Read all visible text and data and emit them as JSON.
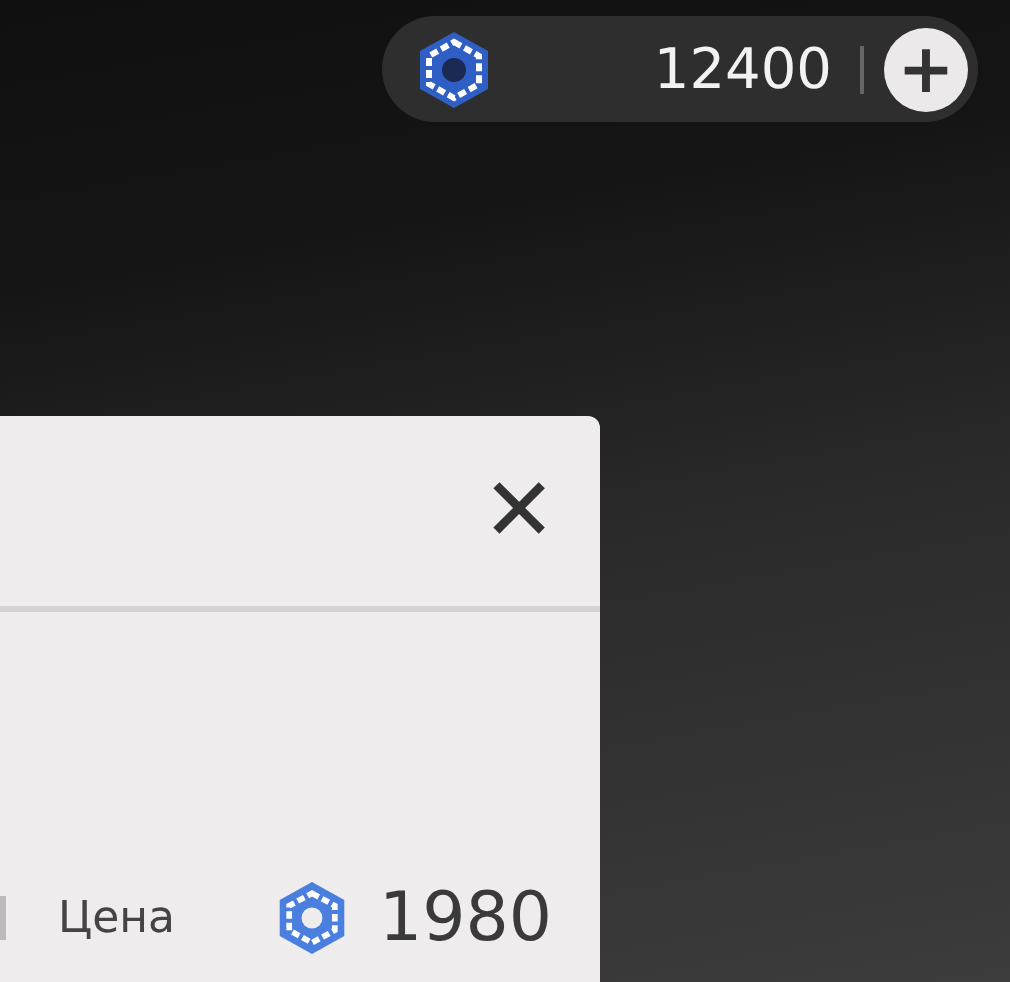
{
  "balance": {
    "amount": "12400",
    "add_button": "+"
  },
  "dialog": {
    "close_button": "✕",
    "price_label": "Цена",
    "price": "1980"
  }
}
